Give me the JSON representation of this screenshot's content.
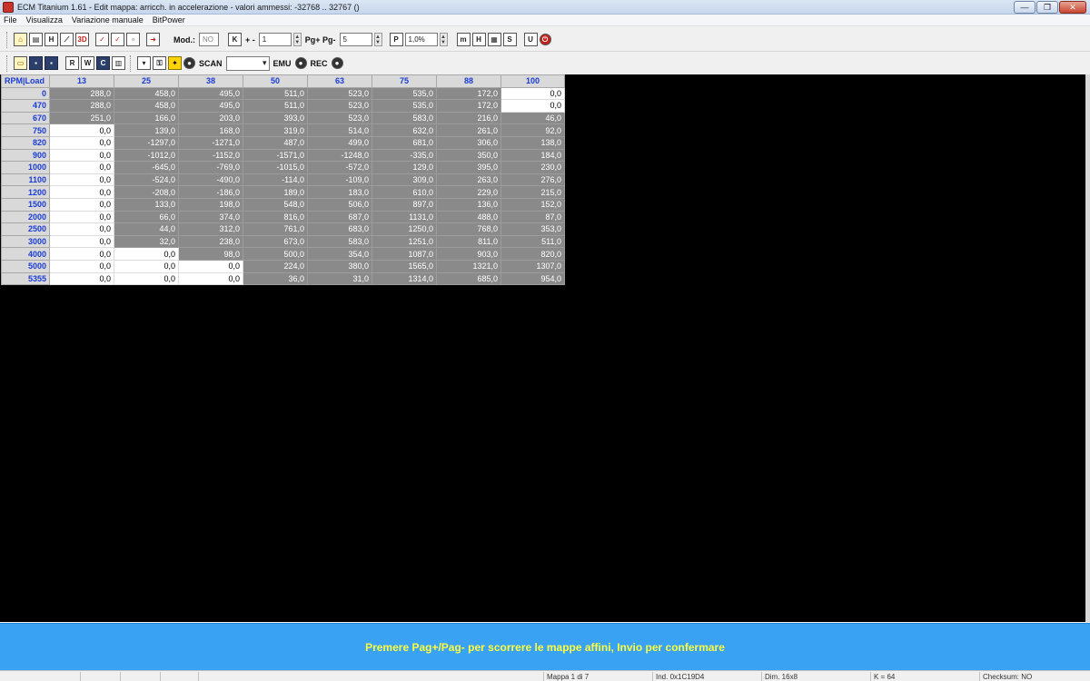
{
  "window": {
    "title": "ECM Titanium 1.61 - Edit mappa: arricch. in accelerazione - valori ammessi: -32768 .. 32767 ()",
    "minimize": "—",
    "maximize": "❐",
    "close": "✕"
  },
  "menu": [
    {
      "id": "file",
      "label": "File"
    },
    {
      "id": "visualizza",
      "label": "Visualizza"
    },
    {
      "id": "variazione",
      "label": "Variazione manuale"
    },
    {
      "id": "bitpower",
      "label": "BitPower"
    }
  ],
  "toolbar": {
    "mod_label": "Mod.:",
    "mod_value": "NO",
    "k_icon": "K",
    "plusminus_label": "+ -",
    "plusminus_value": "1",
    "pg_label": "Pg+ Pg-",
    "pg_value": "5",
    "p_icon": "P",
    "percent_value": "1,0%",
    "scan_label": "SCAN",
    "emu_label": "EMU",
    "rec_label": "REC",
    "icons": {
      "home": "home-icon",
      "duplicate": "duplicate-icon",
      "hex": "hex-view-icon",
      "graph2d": "graph-2d-icon",
      "graph3d": "graph-3d-icon",
      "check": "check-icon",
      "check_all": "check-all-icon",
      "cancel": "cancel-icon",
      "exit": "exit-icon",
      "open": "open-folder-icon",
      "save": "save-icon",
      "save_as": "save-as-icon"
    }
  },
  "table": {
    "corner": "RPM|Load",
    "columns": [
      "13",
      "25",
      "38",
      "50",
      "63",
      "75",
      "88",
      "100"
    ],
    "rows": [
      {
        "rpm": "0",
        "values": [
          "288,0",
          "458,0",
          "495,0",
          "511,0",
          "523,0",
          "535,0",
          "172,0",
          "0,0"
        ],
        "white": [
          false,
          false,
          false,
          false,
          false,
          false,
          false,
          true
        ]
      },
      {
        "rpm": "470",
        "values": [
          "288,0",
          "458,0",
          "495,0",
          "511,0",
          "523,0",
          "535,0",
          "172,0",
          "0,0"
        ],
        "white": [
          false,
          false,
          false,
          false,
          false,
          false,
          false,
          true
        ]
      },
      {
        "rpm": "670",
        "values": [
          "251,0",
          "166,0",
          "203,0",
          "393,0",
          "523,0",
          "583,0",
          "216,0",
          "46,0"
        ],
        "white": [
          false,
          false,
          false,
          false,
          false,
          false,
          false,
          false
        ]
      },
      {
        "rpm": "750",
        "values": [
          "0,0",
          "139,0",
          "168,0",
          "319,0",
          "514,0",
          "632,0",
          "261,0",
          "92,0"
        ],
        "white": [
          true,
          false,
          false,
          false,
          false,
          false,
          false,
          false
        ]
      },
      {
        "rpm": "820",
        "values": [
          "0,0",
          "-1297,0",
          "-1271,0",
          "487,0",
          "499,0",
          "681,0",
          "306,0",
          "138,0"
        ],
        "white": [
          true,
          false,
          false,
          false,
          false,
          false,
          false,
          false
        ]
      },
      {
        "rpm": "900",
        "values": [
          "0,0",
          "-1012,0",
          "-1152,0",
          "-1571,0",
          "-1248,0",
          "-335,0",
          "350,0",
          "184,0"
        ],
        "white": [
          true,
          false,
          false,
          false,
          false,
          false,
          false,
          false
        ]
      },
      {
        "rpm": "1000",
        "values": [
          "0,0",
          "-645,0",
          "-769,0",
          "-1015,0",
          "-572,0",
          "129,0",
          "395,0",
          "230,0"
        ],
        "white": [
          true,
          false,
          false,
          false,
          false,
          false,
          false,
          false
        ]
      },
      {
        "rpm": "1100",
        "values": [
          "0,0",
          "-524,0",
          "-490,0",
          "-114,0",
          "-109,0",
          "309,0",
          "263,0",
          "276,0"
        ],
        "white": [
          true,
          false,
          false,
          false,
          false,
          false,
          false,
          false
        ]
      },
      {
        "rpm": "1200",
        "values": [
          "0,0",
          "-208,0",
          "-186,0",
          "189,0",
          "183,0",
          "610,0",
          "229,0",
          "215,0"
        ],
        "white": [
          true,
          false,
          false,
          false,
          false,
          false,
          false,
          false
        ]
      },
      {
        "rpm": "1500",
        "values": [
          "0,0",
          "133,0",
          "198,0",
          "548,0",
          "506,0",
          "897,0",
          "136,0",
          "152,0"
        ],
        "white": [
          true,
          false,
          false,
          false,
          false,
          false,
          false,
          false
        ]
      },
      {
        "rpm": "2000",
        "values": [
          "0,0",
          "66,0",
          "374,0",
          "816,0",
          "687,0",
          "1131,0",
          "488,0",
          "87,0"
        ],
        "white": [
          true,
          false,
          false,
          false,
          false,
          false,
          false,
          false
        ]
      },
      {
        "rpm": "2500",
        "values": [
          "0,0",
          "44,0",
          "312,0",
          "761,0",
          "683,0",
          "1250,0",
          "768,0",
          "353,0"
        ],
        "white": [
          true,
          false,
          false,
          false,
          false,
          false,
          false,
          false
        ]
      },
      {
        "rpm": "3000",
        "values": [
          "0,0",
          "32,0",
          "238,0",
          "673,0",
          "583,0",
          "1251,0",
          "811,0",
          "511,0"
        ],
        "white": [
          true,
          false,
          false,
          false,
          false,
          false,
          false,
          false
        ]
      },
      {
        "rpm": "4000",
        "values": [
          "0,0",
          "0,0",
          "98,0",
          "500,0",
          "354,0",
          "1087,0",
          "903,0",
          "820,0"
        ],
        "white": [
          true,
          true,
          false,
          false,
          false,
          false,
          false,
          false
        ]
      },
      {
        "rpm": "5000",
        "values": [
          "0,0",
          "0,0",
          "0,0",
          "224,0",
          "380,0",
          "1565,0",
          "1321,0",
          "1307,0"
        ],
        "white": [
          true,
          true,
          true,
          false,
          false,
          false,
          false,
          false
        ]
      },
      {
        "rpm": "5355",
        "values": [
          "0,0",
          "0,0",
          "0,0",
          "36,0",
          "31,0",
          "1314,0",
          "685,0",
          "954,0"
        ],
        "white": [
          true,
          true,
          true,
          false,
          false,
          false,
          false,
          false
        ]
      }
    ]
  },
  "info_bar": "Premere Pag+/Pag- per scorrere le mappe affini, Invio per confermare",
  "status": {
    "mappa": "Mappa 1 di 7",
    "ind": "Ind. 0x1C19D4",
    "dim": "Dim. 16x8",
    "k": "K = 64",
    "checksum": "Checksum: NO"
  },
  "colors": {
    "cell_gray": "#8a8a8a",
    "cell_white": "#ffffff",
    "header_text": "#1a3cd6",
    "info_bar": "#3aa2f2",
    "info_text": "#ffff3c",
    "main_bg": "#000000"
  }
}
